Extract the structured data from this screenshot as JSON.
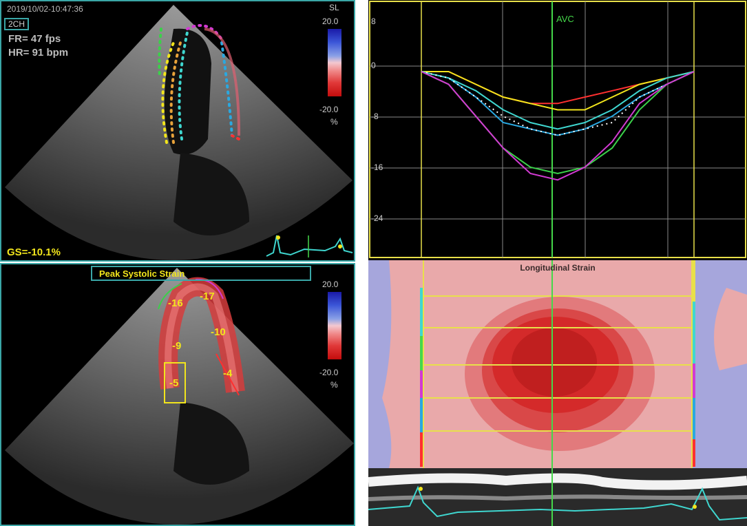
{
  "echo_panel": {
    "timestamp": "2019/10/02-10:47:36",
    "view": "2CH",
    "frame_rate": "FR= 47 fps",
    "heart_rate": "HR= 91 bpm",
    "global_strain": "GS=-10.1%",
    "mode": "SL",
    "colorbar_max": "20.0",
    "colorbar_min": "-20.0",
    "colorbar_unit": "%"
  },
  "peak_panel": {
    "title": "Peak Systolic Strain",
    "colorbar_max": "20.0",
    "colorbar_min": "-20.0",
    "colorbar_unit": "%",
    "segments": [
      "-16",
      "-17",
      "-9",
      "-10",
      "-5",
      "-4"
    ]
  },
  "strain_curves": {
    "marker_label": "AVC",
    "y_ticks": [
      "8",
      "0",
      "-8",
      "-16",
      "-24"
    ]
  },
  "strain_map": {
    "title": "Longitudinal Strain"
  },
  "colors": {
    "frame": "#3aa7a7",
    "accent_yellow": "#f2e51c",
    "avc_green": "#45d84a"
  },
  "chart_data": {
    "type": "line",
    "x": [
      0,
      10,
      20,
      30,
      40,
      50,
      60,
      70,
      80,
      90,
      100
    ],
    "ylim": [
      -24,
      8
    ],
    "series": [
      {
        "color": "#ff3030",
        "values": [
          0,
          0,
          -2,
          -4,
          -5,
          -5,
          -4,
          -3,
          -2,
          -1,
          0
        ]
      },
      {
        "color": "#f2e51c",
        "values": [
          0,
          0,
          -2,
          -4,
          -5,
          -6,
          -6,
          -4,
          -2,
          -1,
          0
        ]
      },
      {
        "color": "#2aa8e0",
        "values": [
          0,
          -1,
          -4,
          -8,
          -9,
          -10,
          -9,
          -7,
          -4,
          -2,
          0
        ]
      },
      {
        "color": "#3fd7d0",
        "values": [
          0,
          -1,
          -3,
          -6,
          -8,
          -9,
          -8,
          -6,
          -3,
          -1,
          0
        ]
      },
      {
        "color": "#ffffff",
        "values": [
          0,
          -1,
          -4,
          -7,
          -9,
          -10,
          -9,
          -8,
          -4,
          -2,
          0
        ]
      },
      {
        "color": "#3bd04a",
        "values": [
          0,
          -2,
          -7,
          -12,
          -15,
          -16,
          -15,
          -12,
          -6,
          -2,
          0
        ]
      },
      {
        "color": "#d23ad2",
        "values": [
          0,
          -2,
          -7,
          -12,
          -16,
          -17,
          -15,
          -11,
          -5,
          -2,
          0
        ]
      }
    ]
  }
}
